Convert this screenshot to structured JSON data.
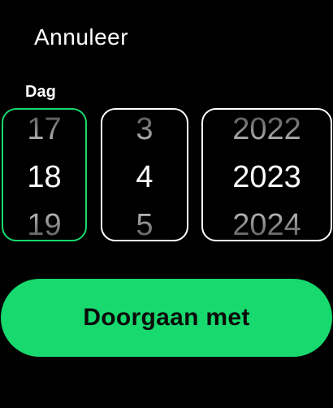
{
  "header": {
    "cancel_label": "Annuleer"
  },
  "picker": {
    "focused_label": "Dag",
    "day": {
      "prev": "17",
      "current": "18",
      "next": "19"
    },
    "month": {
      "prev": "3",
      "current": "4",
      "next": "5"
    },
    "year": {
      "prev": "2022",
      "current": "2023",
      "next": "2024"
    }
  },
  "actions": {
    "continue_label": "Doorgaan met"
  },
  "colors": {
    "background": "#000000",
    "accent": "#17d96e",
    "text": "#ffffff",
    "button_text": "#0a0a0a"
  }
}
